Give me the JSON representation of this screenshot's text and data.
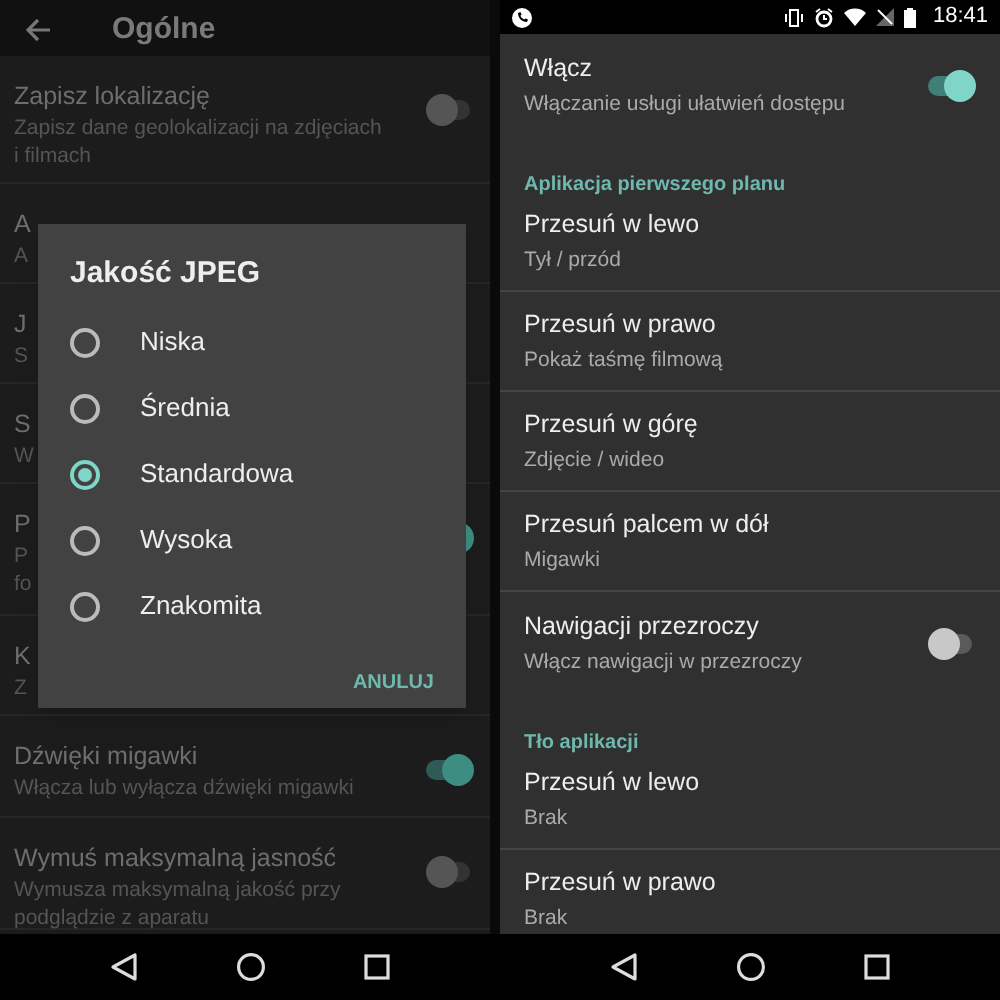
{
  "left_screen": {
    "header": {
      "title": "Ogólne"
    },
    "settings": [
      {
        "lines": [
          "Zapisz lokalizację",
          "Zapisz dane geolokalizacji na zdjęciach",
          "i filmach"
        ],
        "kind": "toggle",
        "on": false
      },
      {
        "lines": [
          "A",
          "A"
        ],
        "kind": "plain"
      },
      {
        "lines": [
          "J",
          "S"
        ],
        "kind": "plain"
      },
      {
        "lines": [
          "S",
          "W"
        ],
        "kind": "plain"
      },
      {
        "lines": [
          "P",
          "P",
          "fo"
        ],
        "kind": "toggle",
        "on": true
      },
      {
        "lines": [
          "K",
          "Z"
        ],
        "kind": "plain"
      },
      {
        "lines": [
          "Dźwięki migawki",
          "Włącza lub wyłącza dźwięki migawki"
        ],
        "kind": "toggle",
        "on": true
      },
      {
        "lines": [
          "Wymuś maksymalną jasność",
          "Wymusza maksymalną jakość przy",
          "podglądzie z aparatu"
        ],
        "kind": "toggle",
        "on": false
      }
    ],
    "dialog": {
      "title": "Jakość JPEG",
      "options": [
        {
          "label": "Niska",
          "selected": false
        },
        {
          "label": "Średnia",
          "selected": false
        },
        {
          "label": "Standardowa",
          "selected": true
        },
        {
          "label": "Wysoka",
          "selected": false
        },
        {
          "label": "Znakomita",
          "selected": false
        }
      ],
      "cancel": "ANULUJ"
    }
  },
  "right_screen": {
    "status_bar": {
      "time": "18:41"
    },
    "items": [
      {
        "kind": "toggle",
        "title": "Włącz",
        "subtitle": "Włączanie usługi ułatwień dostępu",
        "on": true
      },
      {
        "kind": "header",
        "title": "Aplikacja pierwszego planu"
      },
      {
        "kind": "plain",
        "title": "Przesuń w lewo",
        "subtitle": "Tył / przód"
      },
      {
        "kind": "plain",
        "title": "Przesuń w prawo",
        "subtitle": "Pokaż taśmę filmową"
      },
      {
        "kind": "plain",
        "title": "Przesuń w górę",
        "subtitle": "Zdjęcie / wideo"
      },
      {
        "kind": "plain",
        "title": "Przesuń palcem w dół",
        "subtitle": "Migawki"
      },
      {
        "kind": "toggle",
        "title": "Nawigacji przezroczy",
        "subtitle": "Włącz nawigacji w przezroczy",
        "on": false
      },
      {
        "kind": "header",
        "title": "Tło aplikacji"
      },
      {
        "kind": "plain",
        "title": "Przesuń w lewo",
        "subtitle": "Brak"
      },
      {
        "kind": "plain",
        "title": "Przesuń w prawo",
        "subtitle": "Brak"
      }
    ]
  }
}
